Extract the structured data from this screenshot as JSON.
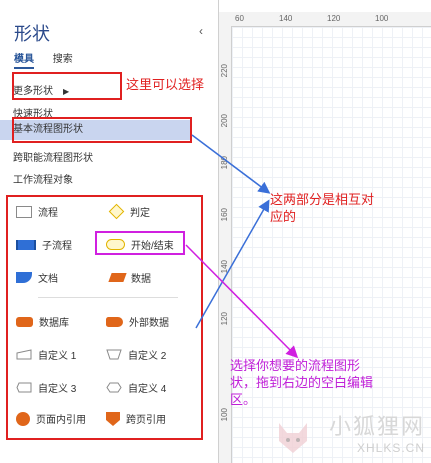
{
  "pane": {
    "title": "形状",
    "collapse_glyph": "‹",
    "tabs": [
      {
        "label": "模具",
        "active": true
      },
      {
        "label": "搜索",
        "active": false
      }
    ],
    "menu": [
      {
        "label": "更多形状",
        "arrow": "▶"
      },
      {
        "label": "快速形状"
      },
      {
        "label": "基本流程图形状",
        "selected": true
      },
      {
        "label": "跨职能流程图形状"
      },
      {
        "label": "工作流程对象"
      }
    ],
    "shapes": [
      {
        "label": "流程",
        "icon": "process-rect-icon"
      },
      {
        "label": "判定",
        "icon": "decision-diamond-icon"
      },
      {
        "label": "子流程",
        "icon": "subprocess-icon"
      },
      {
        "label": "开始/结束",
        "icon": "start-end-terminal-icon"
      },
      {
        "label": "文档",
        "icon": "document-icon"
      },
      {
        "label": "数据",
        "icon": "data-parallelogram-icon"
      },
      {
        "label": "数据库",
        "icon": "database-icon"
      },
      {
        "label": "外部数据",
        "icon": "external-data-icon"
      },
      {
        "label": "自定义 1",
        "icon": "custom-1-icon"
      },
      {
        "label": "自定义 2",
        "icon": "custom-2-icon"
      },
      {
        "label": "自定义 3",
        "icon": "custom-3-icon"
      },
      {
        "label": "自定义 4",
        "icon": "custom-4-icon"
      },
      {
        "label": "页面内引用",
        "icon": "on-page-reference-icon"
      },
      {
        "label": "跨页引用",
        "icon": "off-page-reference-icon"
      }
    ]
  },
  "ruler": {
    "top": [
      "60",
      "140",
      "120",
      "100"
    ],
    "left": [
      "220",
      "200",
      "180",
      "160",
      "140",
      "120",
      "100"
    ]
  },
  "annotations": {
    "select_here": "这里可以选择",
    "correspond_line1": "这两部分是相互对",
    "correspond_line2": "应的",
    "drag_line1": "选择你想要的流程图形",
    "drag_line2": "状，拖到右边的空白编辑",
    "drag_line3": "区。"
  },
  "watermark": {
    "cn": "小狐狸网",
    "en": "XHLKS.CN"
  },
  "colors": {
    "accent": "#2b579a",
    "selected_bg": "#c9d5ef",
    "annot_red": "#e02020",
    "annot_pink": "#c020d8",
    "arrow_blue": "#3a6fd8"
  }
}
